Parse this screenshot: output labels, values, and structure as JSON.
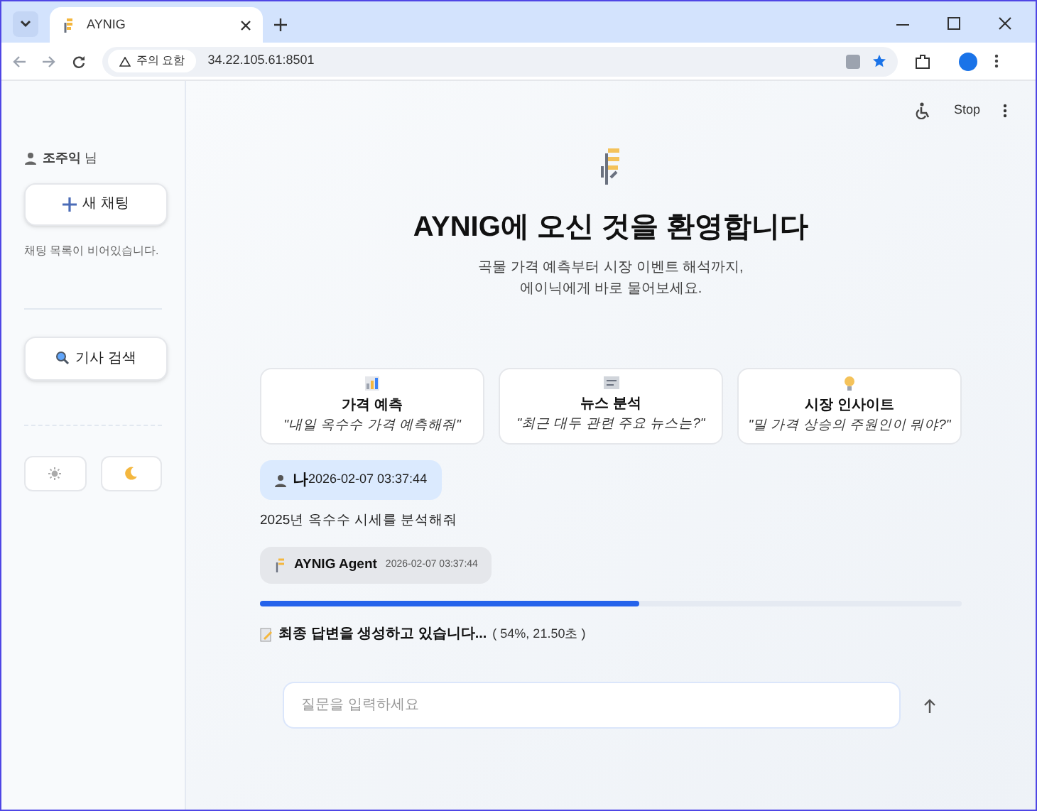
{
  "browser": {
    "tab_title": "AYNIG",
    "security_label": "주의 요함",
    "address": "34.22.105.61:8501"
  },
  "sidebar": {
    "user_name": "조주익",
    "user_suffix": "님",
    "new_chat_button": "새 채팅",
    "empty_text": "채팅 목록이 비어있습니다.",
    "search_button": "기사 검색"
  },
  "header": {
    "stop_label": "Stop"
  },
  "welcome": {
    "title": "AYNIG에 오신 것을 환영합니다",
    "subtitle_lines": [
      "곡물 가격 예측부터 시장 이벤트 해석까지,",
      "에이닉에게 바로 물어보세요."
    ]
  },
  "cards": [
    {
      "kind": "chart",
      "title": "가격 예측",
      "example": "\"내일 옥수수 가격 예측해줘\""
    },
    {
      "kind": "news",
      "title": "뉴스 분석",
      "example": "\"최근 대두 관련 주요 뉴스는?\""
    },
    {
      "kind": "bulb",
      "title": "시장 인사이트",
      "example": "\"밀 가격 상승의 주원인이 뭐야?\""
    }
  ],
  "messages": [
    {
      "kind": "user",
      "name": "나",
      "time": "2026-02-07 03:37:44",
      "text": "2025년 옥수수 시세를 분석해줘"
    },
    {
      "kind": "agent",
      "name": "AYNIG Agent",
      "time": "2026-02-07 03:37:44"
    }
  ],
  "progress": {
    "level": 0.54,
    "status": "최종 답변을 생성하고 있습니다...",
    "detail": "( 54%, 21.50초 )"
  },
  "chat_input": {
    "placeholder": "질문을 입력하세요"
  }
}
